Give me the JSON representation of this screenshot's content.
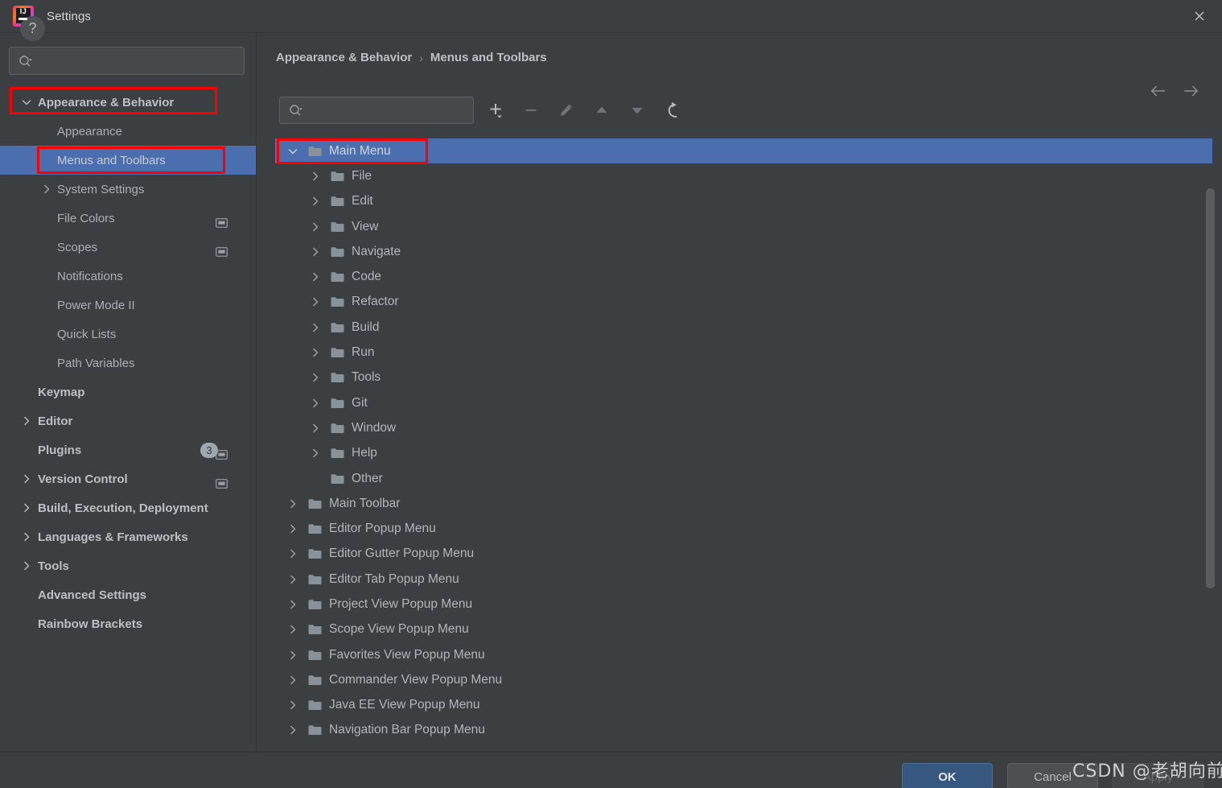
{
  "window": {
    "title": "Settings",
    "logo_icon": "intellij-idea-logo",
    "logo_text": "IJ",
    "close_icon": "close-icon"
  },
  "sidebar": {
    "search": {
      "placeholder": "",
      "value": "",
      "icon": "search-icon",
      "dropdown_icon": "chevron-down-icon"
    },
    "items": [
      {
        "label": "Appearance & Behavior",
        "indent": 0,
        "chevron": "down",
        "bold": true,
        "selected": false,
        "badge": null,
        "proj_icon": false
      },
      {
        "label": "Appearance",
        "indent": 1,
        "chevron": "none",
        "bold": false,
        "selected": false,
        "badge": null,
        "proj_icon": false
      },
      {
        "label": "Menus and Toolbars",
        "indent": 1,
        "chevron": "none",
        "bold": false,
        "selected": true,
        "badge": null,
        "proj_icon": false
      },
      {
        "label": "System Settings",
        "indent": 1,
        "chevron": "right",
        "bold": false,
        "selected": false,
        "badge": null,
        "proj_icon": false
      },
      {
        "label": "File Colors",
        "indent": 1,
        "chevron": "none",
        "bold": false,
        "selected": false,
        "badge": null,
        "proj_icon": true
      },
      {
        "label": "Scopes",
        "indent": 1,
        "chevron": "none",
        "bold": false,
        "selected": false,
        "badge": null,
        "proj_icon": true
      },
      {
        "label": "Notifications",
        "indent": 1,
        "chevron": "none",
        "bold": false,
        "selected": false,
        "badge": null,
        "proj_icon": false
      },
      {
        "label": "Power Mode II",
        "indent": 1,
        "chevron": "none",
        "bold": false,
        "selected": false,
        "badge": null,
        "proj_icon": false
      },
      {
        "label": "Quick Lists",
        "indent": 1,
        "chevron": "none",
        "bold": false,
        "selected": false,
        "badge": null,
        "proj_icon": false
      },
      {
        "label": "Path Variables",
        "indent": 1,
        "chevron": "none",
        "bold": false,
        "selected": false,
        "badge": null,
        "proj_icon": false
      },
      {
        "label": "Keymap",
        "indent": 0,
        "chevron": "none",
        "bold": true,
        "selected": false,
        "badge": null,
        "proj_icon": false
      },
      {
        "label": "Editor",
        "indent": 0,
        "chevron": "right",
        "bold": true,
        "selected": false,
        "badge": null,
        "proj_icon": false
      },
      {
        "label": "Plugins",
        "indent": 0,
        "chevron": "none",
        "bold": true,
        "selected": false,
        "badge": "3",
        "proj_icon": true
      },
      {
        "label": "Version Control",
        "indent": 0,
        "chevron": "right",
        "bold": true,
        "selected": false,
        "badge": null,
        "proj_icon": true
      },
      {
        "label": "Build, Execution, Deployment",
        "indent": 0,
        "chevron": "right",
        "bold": true,
        "selected": false,
        "badge": null,
        "proj_icon": false
      },
      {
        "label": "Languages & Frameworks",
        "indent": 0,
        "chevron": "right",
        "bold": true,
        "selected": false,
        "badge": null,
        "proj_icon": false
      },
      {
        "label": "Tools",
        "indent": 0,
        "chevron": "right",
        "bold": true,
        "selected": false,
        "badge": null,
        "proj_icon": false
      },
      {
        "label": "Advanced Settings",
        "indent": 0,
        "chevron": "none",
        "bold": true,
        "selected": false,
        "badge": null,
        "proj_icon": false
      },
      {
        "label": "Rainbow Brackets",
        "indent": 0,
        "chevron": "none",
        "bold": true,
        "selected": false,
        "badge": null,
        "proj_icon": false
      }
    ]
  },
  "main": {
    "breadcrumb": {
      "root": "Appearance & Behavior",
      "separator": "›",
      "current": "Menus and Toolbars"
    },
    "nav": {
      "back_icon": "arrow-left-icon",
      "forward_icon": "arrow-right-icon"
    },
    "toolbar": {
      "search": {
        "placeholder": "",
        "value": "",
        "icon": "search-icon",
        "dropdown_icon": "chevron-down-icon"
      },
      "buttons": [
        {
          "name": "add-button",
          "icon": "plus-icon",
          "enabled": true
        },
        {
          "name": "remove-button",
          "icon": "minus-icon",
          "enabled": false
        },
        {
          "name": "edit-button",
          "icon": "pencil-icon",
          "enabled": false
        },
        {
          "name": "move-up-button",
          "icon": "triangle-up-icon",
          "enabled": false
        },
        {
          "name": "move-down-button",
          "icon": "triangle-down-icon",
          "enabled": false
        },
        {
          "name": "restore-button",
          "icon": "revert-arrow-icon",
          "enabled": true
        }
      ]
    },
    "tree": [
      {
        "label": "Main Menu",
        "indent": 0,
        "chevron": "down",
        "selected": true
      },
      {
        "label": "File",
        "indent": 1,
        "chevron": "right",
        "selected": false
      },
      {
        "label": "Edit",
        "indent": 1,
        "chevron": "right",
        "selected": false
      },
      {
        "label": "View",
        "indent": 1,
        "chevron": "right",
        "selected": false
      },
      {
        "label": "Navigate",
        "indent": 1,
        "chevron": "right",
        "selected": false
      },
      {
        "label": "Code",
        "indent": 1,
        "chevron": "right",
        "selected": false
      },
      {
        "label": "Refactor",
        "indent": 1,
        "chevron": "right",
        "selected": false
      },
      {
        "label": "Build",
        "indent": 1,
        "chevron": "right",
        "selected": false
      },
      {
        "label": "Run",
        "indent": 1,
        "chevron": "right",
        "selected": false
      },
      {
        "label": "Tools",
        "indent": 1,
        "chevron": "right",
        "selected": false
      },
      {
        "label": "Git",
        "indent": 1,
        "chevron": "right",
        "selected": false
      },
      {
        "label": "Window",
        "indent": 1,
        "chevron": "right",
        "selected": false
      },
      {
        "label": "Help",
        "indent": 1,
        "chevron": "right",
        "selected": false
      },
      {
        "label": "Other",
        "indent": 1,
        "chevron": "none",
        "selected": false
      },
      {
        "label": "Main Toolbar",
        "indent": 0,
        "chevron": "right",
        "selected": false
      },
      {
        "label": "Editor Popup Menu",
        "indent": 0,
        "chevron": "right",
        "selected": false
      },
      {
        "label": "Editor Gutter Popup Menu",
        "indent": 0,
        "chevron": "right",
        "selected": false
      },
      {
        "label": "Editor Tab Popup Menu",
        "indent": 0,
        "chevron": "right",
        "selected": false
      },
      {
        "label": "Project View Popup Menu",
        "indent": 0,
        "chevron": "right",
        "selected": false
      },
      {
        "label": "Scope View Popup Menu",
        "indent": 0,
        "chevron": "right",
        "selected": false
      },
      {
        "label": "Favorites View Popup Menu",
        "indent": 0,
        "chevron": "right",
        "selected": false
      },
      {
        "label": "Commander View Popup Menu",
        "indent": 0,
        "chevron": "right",
        "selected": false
      },
      {
        "label": "Java EE View Popup Menu",
        "indent": 0,
        "chevron": "right",
        "selected": false
      },
      {
        "label": "Navigation Bar Popup Menu",
        "indent": 0,
        "chevron": "right",
        "selected": false
      }
    ]
  },
  "footer": {
    "help_label": "?",
    "ok_label": "OK",
    "cancel_label": "Cancel",
    "apply_label": "Apply"
  },
  "watermark": {
    "text": "CSDN @老胡向前冲"
  },
  "colors": {
    "background": "#3c3f41",
    "selection": "#4b6eaf",
    "accent_button": "#365880",
    "annotation": "#fa0000",
    "text": "#b0b6bb",
    "folder": "#8a9299"
  }
}
